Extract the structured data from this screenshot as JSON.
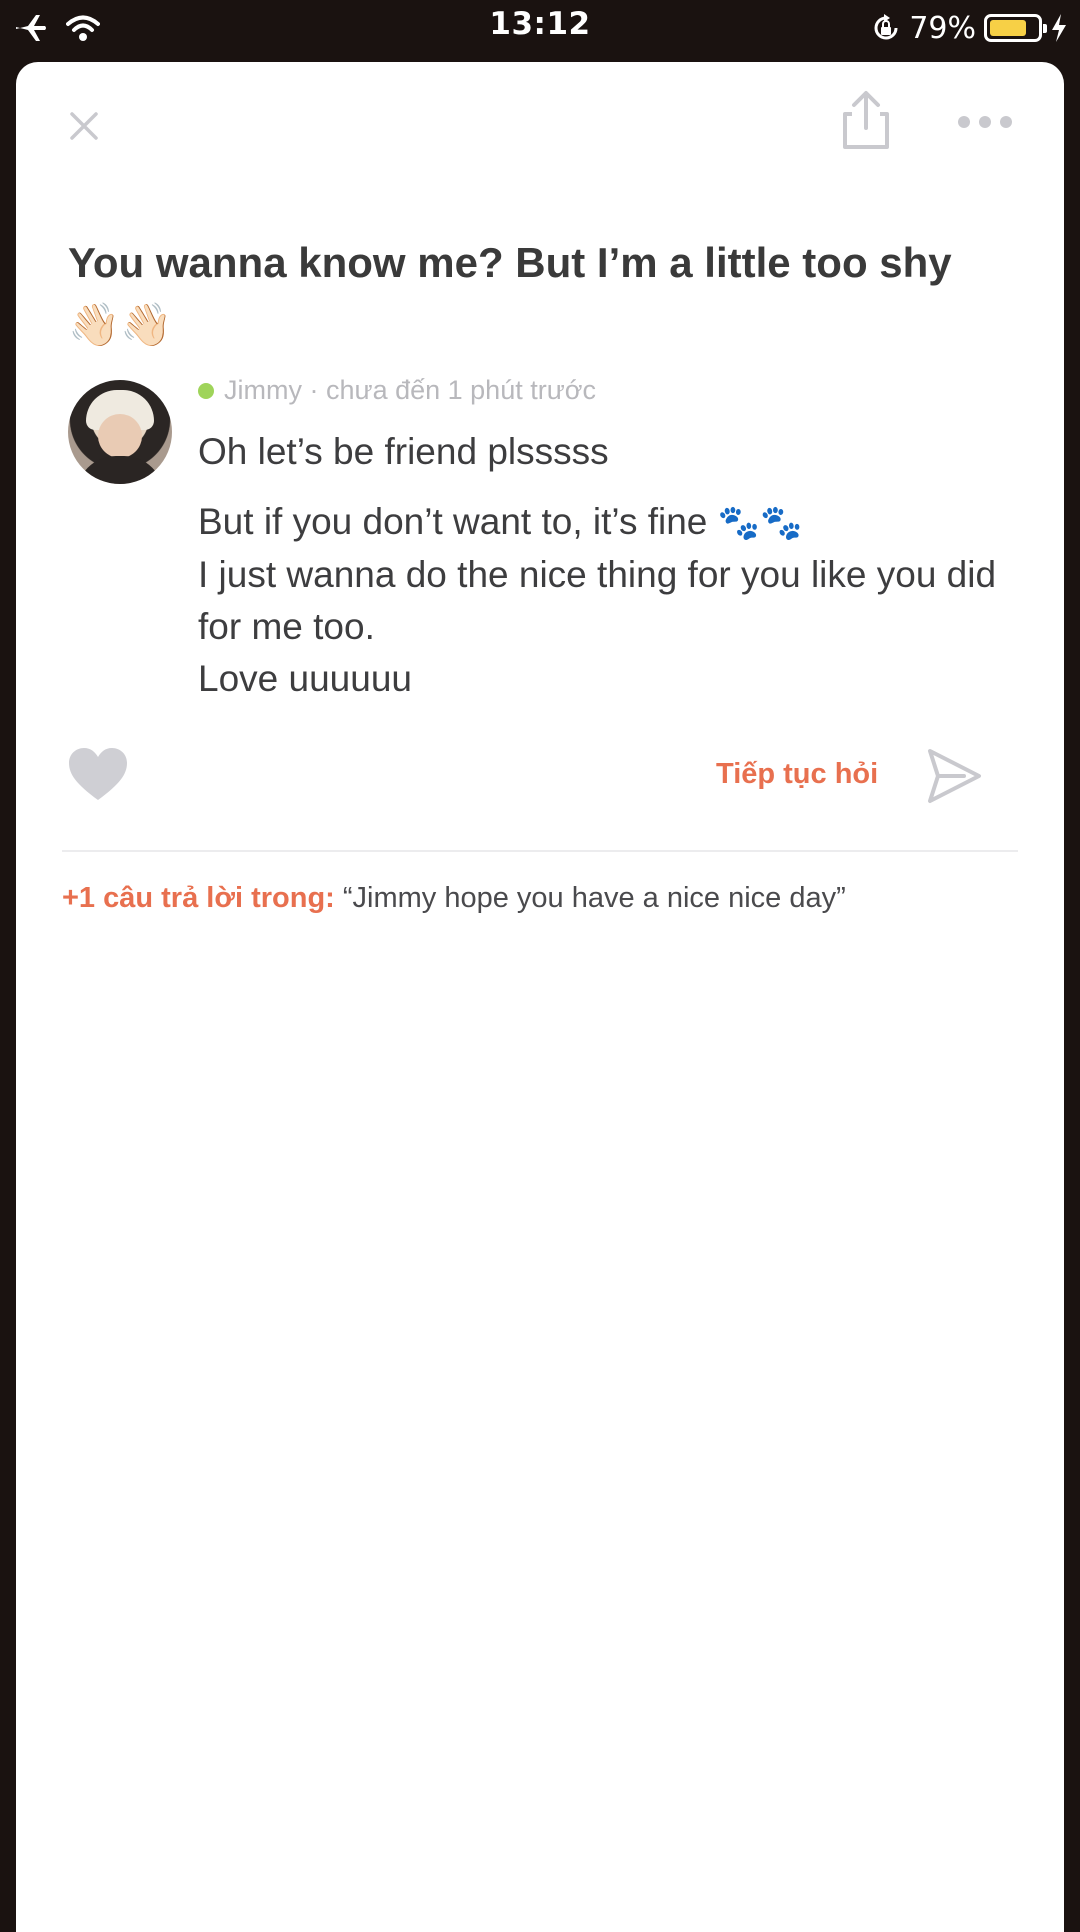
{
  "status_bar": {
    "time": "13:12",
    "battery_percent": "79%",
    "battery_level": 0.79,
    "icons": [
      "airplane-icon",
      "wifi-icon",
      "orientation-lock-icon",
      "battery-icon",
      "charging-bolt-icon"
    ]
  },
  "header": {
    "icons": [
      "close-icon",
      "share-icon",
      "more-icon"
    ]
  },
  "question": {
    "text": "You wanna know me? But I’m a little too shy",
    "emoji": "👋🏻👋🏻"
  },
  "answer": {
    "author": "Jimmy",
    "separator": " · ",
    "time_ago": "chưa đến 1 phút trước",
    "line1": "Oh let’s be friend plsssss",
    "line2": "But if you don’t want to, it’s fine",
    "paws": "🐾🐾",
    "line3": "I just wanna do the nice thing for you like you did for me too.",
    "line4": "Love uuuuuu"
  },
  "actions": {
    "continue_label": "Tiếp tục hỏi",
    "icons": [
      "heart-icon",
      "send-icon"
    ]
  },
  "more_answers": {
    "prefix": "+1 câu trả lời trong:",
    "quote": " “Jimmy hope you have a nice nice day”"
  },
  "colors": {
    "accent": "#e8704f",
    "online": "#9fd45a",
    "icon_gray": "#c9c9ce",
    "text_dark": "#3a3a3a",
    "battery": "#f7d046"
  }
}
